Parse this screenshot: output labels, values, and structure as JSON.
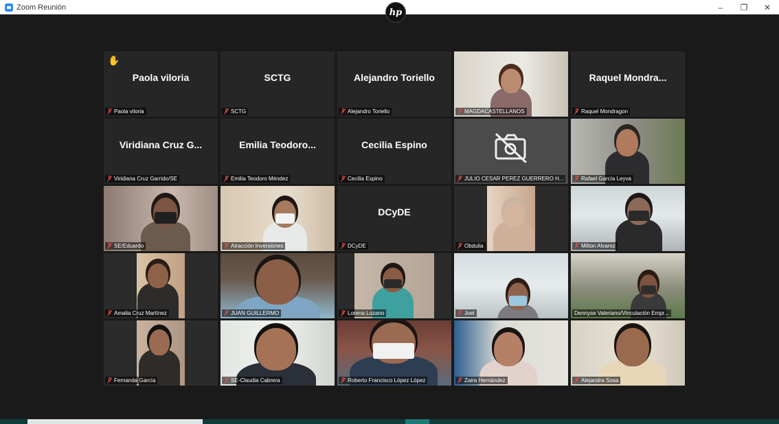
{
  "window": {
    "title": "Zoom Reunión",
    "controls": {
      "minimize": "–",
      "maximize": "❐",
      "close": "✕"
    }
  },
  "logo": {
    "text": "hp"
  },
  "participants": [
    {
      "display": "Paola viloria",
      "label": "Paola viloria",
      "type": "name",
      "hand_raised": true
    },
    {
      "display": "SCTG",
      "label": "SCTG",
      "type": "name"
    },
    {
      "display": "Alejandro Toriello",
      "label": "Alejandro Toriello",
      "type": "name"
    },
    {
      "label": "MAGDACASTELLANOS",
      "type": "video"
    },
    {
      "display": "Raquel Mondra...",
      "label": "Raquel Mondragon",
      "type": "name"
    },
    {
      "display": "Viridiana Cruz G...",
      "label": "Viridiana Cruz Garrido/SE",
      "type": "name"
    },
    {
      "display": "Emilia Teodoro...",
      "label": "Emilia Teodoro Méndez",
      "type": "name"
    },
    {
      "display": "Cecilia Espino",
      "label": "Cecilia Espino",
      "type": "name"
    },
    {
      "label": "JULIO CESAR PEREZ GUERRERO H...",
      "type": "camoff"
    },
    {
      "label": "Rafael García Leyva",
      "type": "video",
      "speaking": true
    },
    {
      "label": "SE/Eduardo",
      "type": "video"
    },
    {
      "label": "Atracción Inversiones",
      "type": "video"
    },
    {
      "display": "DCyDE",
      "label": "DCyDE",
      "type": "name"
    },
    {
      "label": "Obdulia",
      "type": "video"
    },
    {
      "label": "Milton Alvarez",
      "type": "video"
    },
    {
      "label": "Amalia Cruz Martínez",
      "type": "video"
    },
    {
      "label": "JUAN GUILLERMO",
      "type": "video"
    },
    {
      "label": "Lorena Lozano",
      "type": "video"
    },
    {
      "label": "Joel",
      "type": "video"
    },
    {
      "label": "Dennyse Valeriano/Vinculación Empr...",
      "type": "video",
      "muted": false
    },
    {
      "label": "Fernanda García",
      "type": "video"
    },
    {
      "label": "SE-Claudia Cabrera",
      "type": "video"
    },
    {
      "label": "Roberto Francisco López López",
      "type": "video"
    },
    {
      "label": "Zaira Hernández",
      "type": "video"
    },
    {
      "label": "Alejandra Sosa",
      "type": "video"
    }
  ],
  "colors": {
    "background": "#1a1a1a",
    "tile": "#262626",
    "active_speaker": "#c6d94a",
    "muted": "#e34b4b",
    "accent": "#2d8cff"
  }
}
